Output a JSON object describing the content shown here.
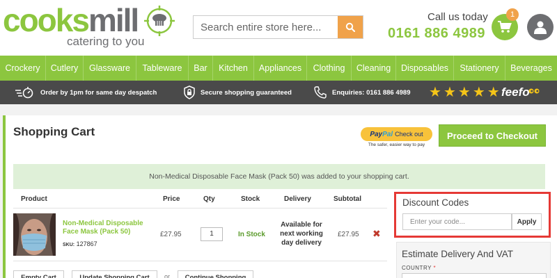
{
  "brand": {
    "name_part1": "cooks",
    "name_part2": "mill",
    "tagline": "catering to you"
  },
  "header": {
    "search_placeholder": "Search entire store here...",
    "call_label": "Call us today",
    "phone": "0161 886 4989",
    "cart_count": "1"
  },
  "nav": {
    "items": [
      "Crockery",
      "Cutlery",
      "Glassware",
      "Tableware",
      "Bar",
      "Kitchen",
      "Appliances",
      "Clothing",
      "Cleaning",
      "Disposables",
      "Stationery",
      "Beverages"
    ]
  },
  "strip": {
    "despatch": "Order by 1pm for same day despatch",
    "secure": "Secure shopping guaranteed",
    "enquiries": "Enquiries: 0161 886 4989",
    "feefo": "feefo"
  },
  "cart": {
    "title": "Shopping Cart",
    "paypal_pay": "Pay",
    "paypal_pal": "Pal",
    "paypal_checkout": "Check out",
    "paypal_note": "The safer, easier way to pay",
    "checkout_label": "Proceed to Checkout",
    "notice": "Non-Medical Disposable Face Mask (Pack 50) was added to your shopping cart.",
    "columns": {
      "product": "Product",
      "price": "Price",
      "qty": "Qty",
      "stock": "Stock",
      "delivery": "Delivery",
      "subtotal": "Subtotal"
    },
    "item": {
      "name": "Non-Medical Disposable Face Mask (Pack 50)",
      "sku_label": "SKU:",
      "sku": "127867",
      "price": "£27.95",
      "qty": "1",
      "stock": "In Stock",
      "delivery": "Available for next working day delivery",
      "subtotal": "£27.95"
    },
    "buttons": {
      "empty": "Empty Cart",
      "update": "Update Shopping Cart",
      "or": "or",
      "continue": "Continue Shopping"
    }
  },
  "discount": {
    "title": "Discount Codes",
    "placeholder": "Enter your code...",
    "apply": "Apply"
  },
  "estimate": {
    "title": "Estimate Delivery And VAT",
    "country_label": "COUNTRY",
    "required_mark": "*"
  },
  "colors": {
    "brand_green": "#8cc63f",
    "brand_grey": "#6d6e71",
    "search_orange": "#f0a24a",
    "highlight_red": "#e53935"
  }
}
